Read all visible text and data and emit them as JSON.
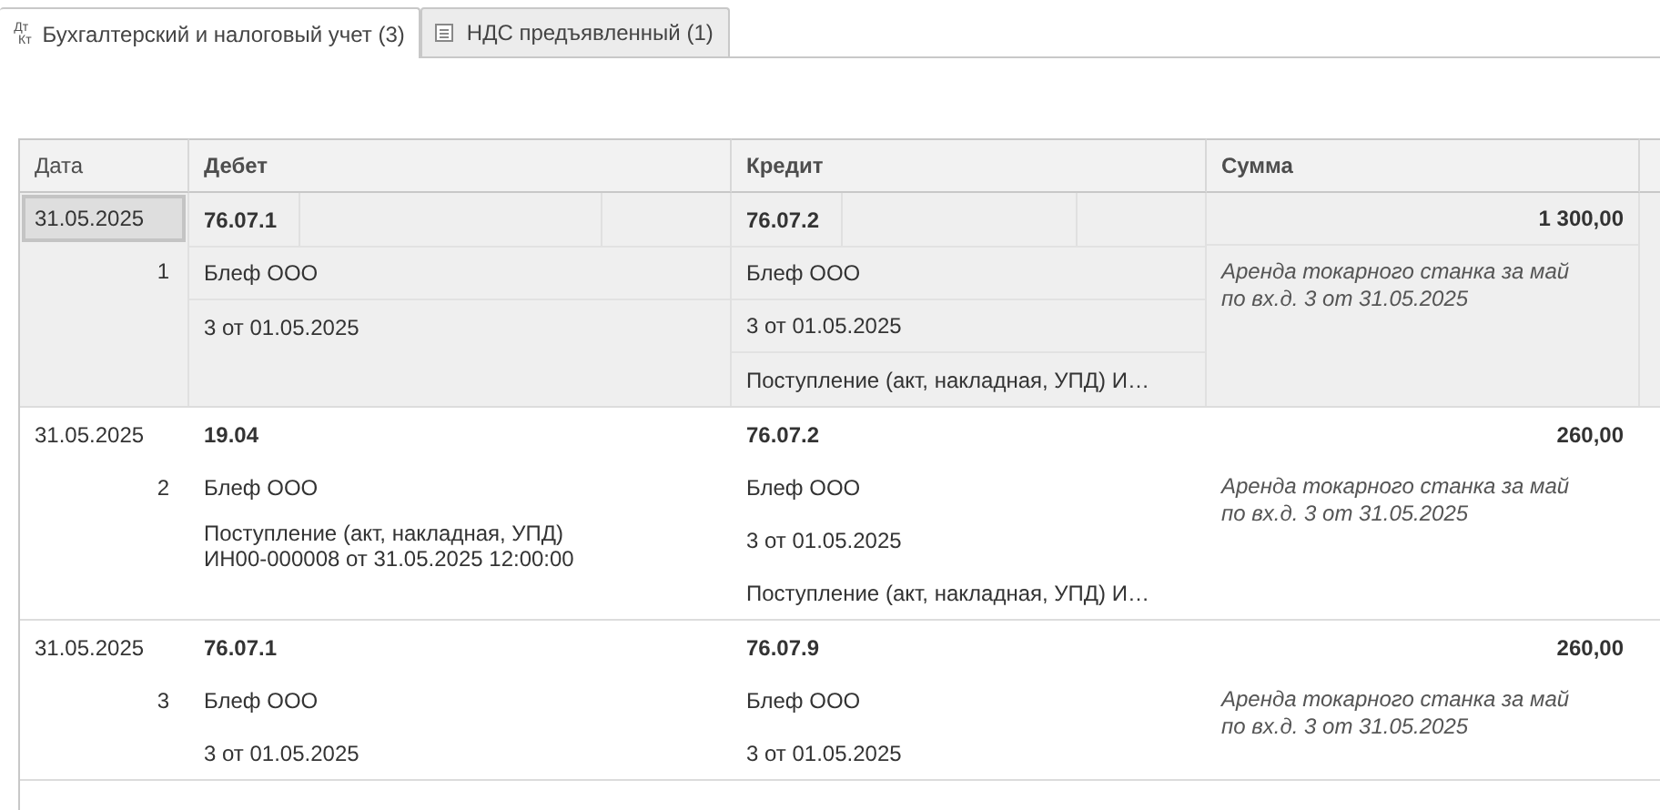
{
  "tabs": [
    {
      "label": "Бухгалтерский и налоговый учет (3)",
      "kind": "accounting",
      "icon_top": "Дт",
      "icon_bottom": "Кт",
      "selected": true
    },
    {
      "label": "НДС предъявленный (1)",
      "kind": "vat",
      "selected": false
    }
  ],
  "table": {
    "columns": [
      "Дата",
      "Дебет",
      "Кредит",
      "Сумма"
    ],
    "rows": [
      {
        "date": "31.05.2025",
        "number": "1",
        "selected": true,
        "debit": {
          "account": "76.07.1",
          "lines": [
            "Блеф ООО",
            "3 от 01.05.2025"
          ]
        },
        "credit": {
          "account": "76.07.2",
          "lines": [
            "Блеф ООО",
            "3 от 01.05.2025",
            "Поступление (акт, накладная, УПД) И…"
          ]
        },
        "sum": "1 300,00",
        "description": "Аренда токарного станка за май по вх.д. 3 от 31.05.2025"
      },
      {
        "date": "31.05.2025",
        "number": "2",
        "selected": false,
        "debit": {
          "account": "19.04",
          "lines": [
            "Блеф ООО",
            "Поступление (акт, накладная, УПД) ИН00-000008 от 31.05.2025 12:00:00"
          ]
        },
        "credit": {
          "account": "76.07.2",
          "lines": [
            "Блеф ООО",
            "3 от 01.05.2025",
            "Поступление (акт, накладная, УПД) И…"
          ]
        },
        "sum": "260,00",
        "description": "Аренда токарного станка за май по вх.д. 3 от 31.05.2025"
      },
      {
        "date": "31.05.2025",
        "number": "3",
        "selected": false,
        "debit": {
          "account": "76.07.1",
          "lines": [
            "Блеф ООО",
            "3 от 01.05.2025"
          ]
        },
        "credit": {
          "account": "76.07.9",
          "lines": [
            "Блеф ООО",
            "3 от 01.05.2025"
          ]
        },
        "sum": "260,00",
        "description": "Аренда токарного станка за май по вх.д. 3 от 31.05.2025"
      }
    ]
  }
}
